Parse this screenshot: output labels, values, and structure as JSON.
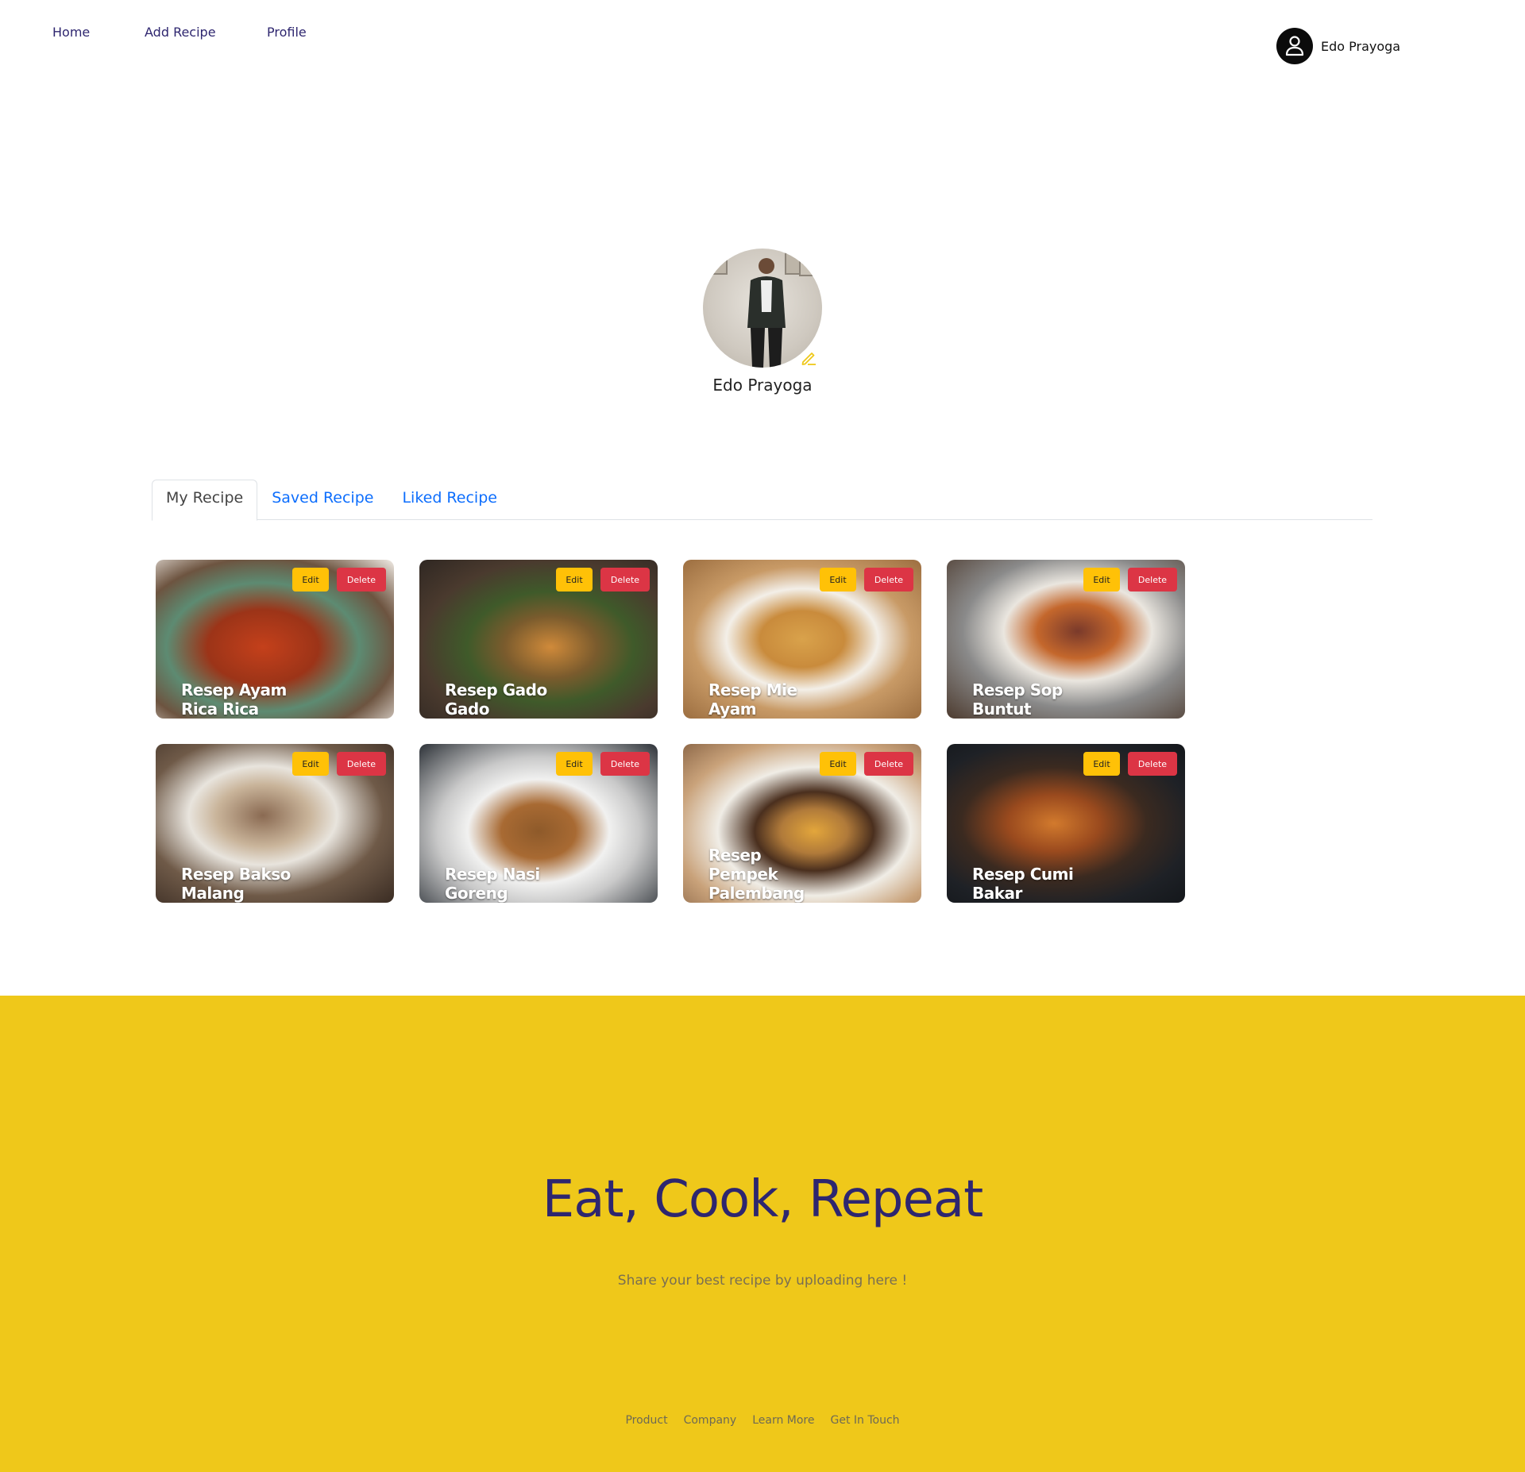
{
  "nav": {
    "home": "Home",
    "add_recipe": "Add Recipe",
    "profile": "Profile",
    "user_name": "Edo Prayoga"
  },
  "profile": {
    "name": "Edo Prayoga"
  },
  "tabs": [
    {
      "label": "My Recipe",
      "active": true
    },
    {
      "label": "Saved Recipe",
      "active": false
    },
    {
      "label": "Liked Recipe",
      "active": false
    }
  ],
  "recipes": [
    {
      "title": "Resep Ayam Rica Rica",
      "edit": "Edit",
      "delete": "Delete"
    },
    {
      "title": "Resep Gado Gado",
      "edit": "Edit",
      "delete": "Delete"
    },
    {
      "title": "Resep Mie Ayam",
      "edit": "Edit",
      "delete": "Delete"
    },
    {
      "title": "Resep Sop Buntut",
      "edit": "Edit",
      "delete": "Delete"
    },
    {
      "title": "Resep Bakso Malang",
      "edit": "Edit",
      "delete": "Delete"
    },
    {
      "title": "Resep Nasi Goreng",
      "edit": "Edit",
      "delete": "Delete"
    },
    {
      "title": "Resep Pempek Palembang",
      "edit": "Edit",
      "delete": "Delete"
    },
    {
      "title": "Resep Cumi Bakar",
      "edit": "Edit",
      "delete": "Delete"
    }
  ],
  "footer": {
    "heading": "Eat, Cook, Repeat",
    "subtitle": "Share your best recipe by uploading here !",
    "links": [
      "Product",
      "Company",
      "Learn More",
      "Get In Touch"
    ]
  },
  "colors": {
    "footer_bg": "#efc81a",
    "heading": "#2e266f",
    "edit_button": "#ffc107",
    "delete_button": "#dc3545",
    "tab_link": "#0d6efd"
  }
}
